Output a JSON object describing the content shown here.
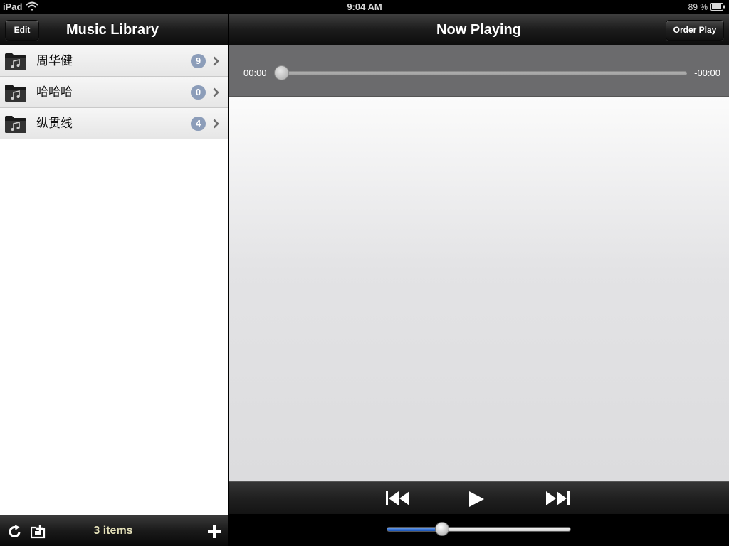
{
  "status_bar": {
    "device": "iPad",
    "time": "9:04 AM",
    "battery": "89 %",
    "icons": [
      "wifi-icon",
      "battery-icon"
    ]
  },
  "library": {
    "edit_label": "Edit",
    "title": "Music Library",
    "folders": [
      {
        "name": "周华健",
        "count": "9",
        "icon": "music-folder-icon"
      },
      {
        "name": "哈哈哈",
        "count": "0",
        "icon": "music-folder-icon"
      },
      {
        "name": "纵贯线",
        "count": "4",
        "icon": "music-folder-icon"
      }
    ],
    "toolbar": {
      "items_count": "3 items",
      "icons": [
        "refresh-icon",
        "add-folder-icon",
        "plus-icon"
      ]
    }
  },
  "now_playing": {
    "title": "Now Playing",
    "order_label": "Order Play",
    "elapsed": "00:00",
    "remaining": "-00:00",
    "progress_fraction": 0.0,
    "volume_fraction": 0.3,
    "controls": [
      "previous-track-icon",
      "play-icon",
      "next-track-icon"
    ]
  },
  "colors": {
    "badge": "#8c9db9",
    "items_text": "#e3dfb8",
    "volume_fill": "#2f6cd1",
    "progress_panel": "#6b6b6d"
  }
}
